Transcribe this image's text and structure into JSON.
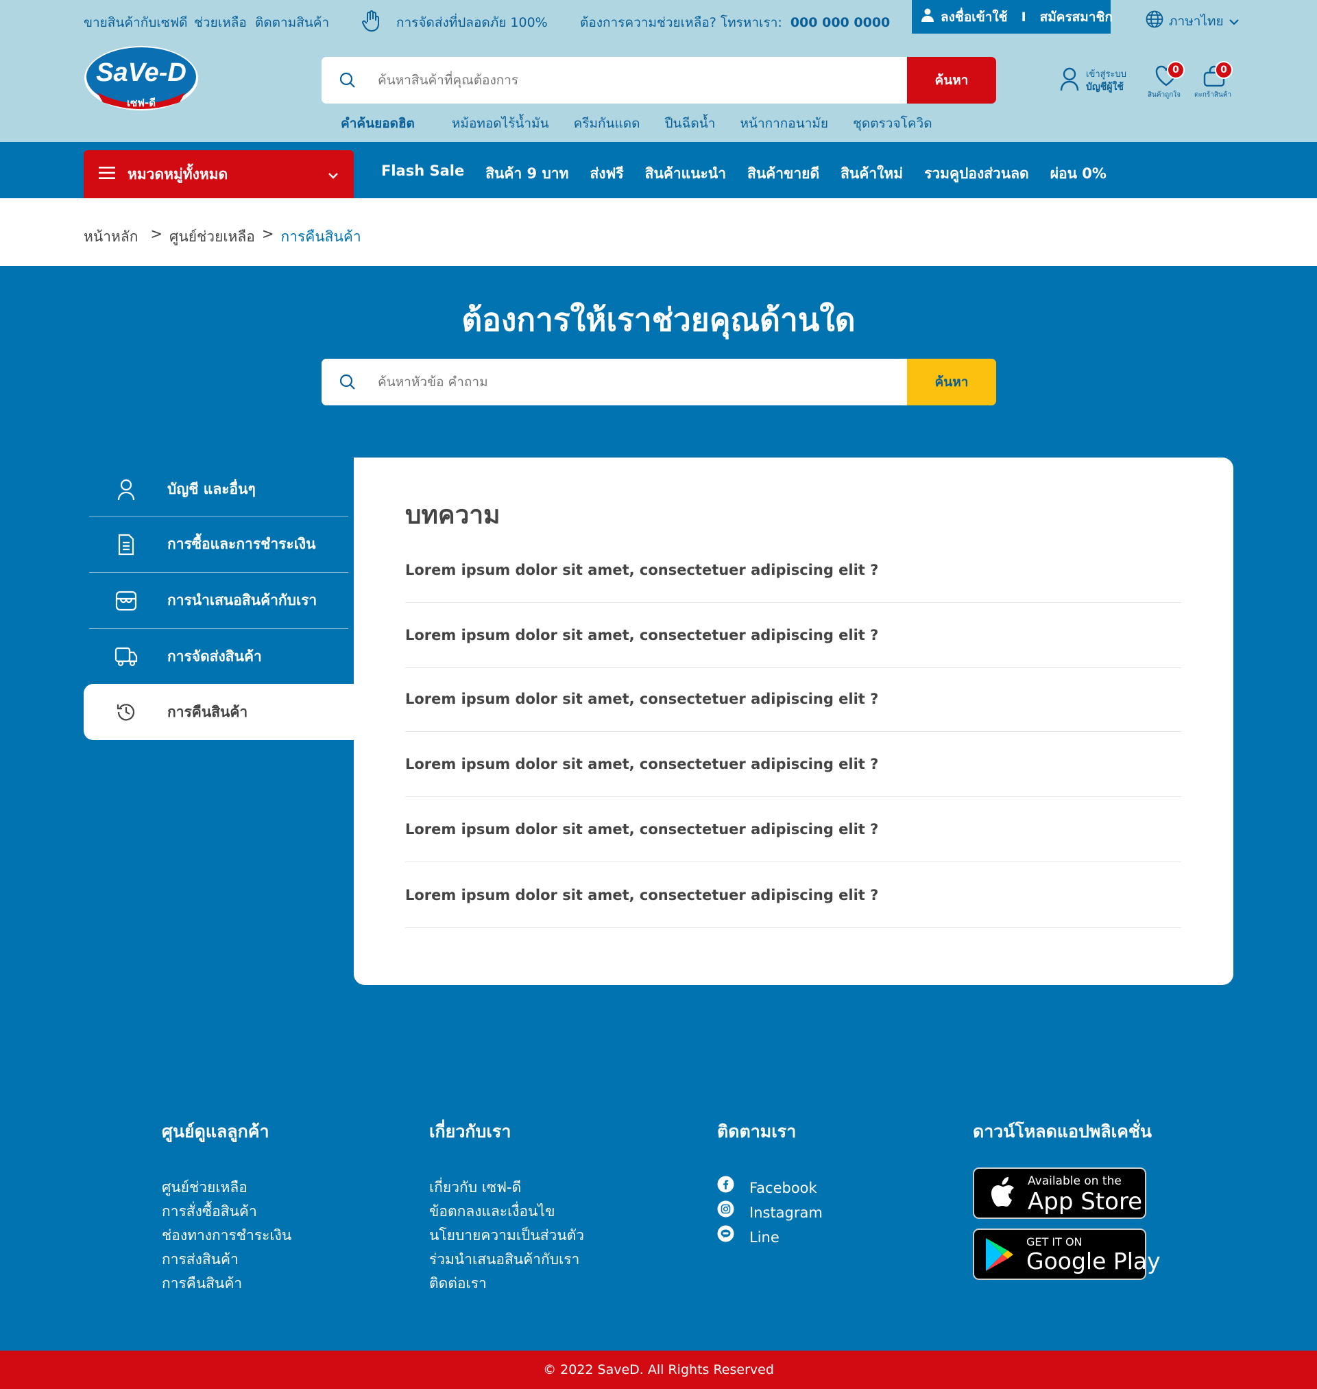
{
  "topbar": {
    "links": [
      "ขายสินค้ากับเซฟดี",
      "ช่วยเหลือ",
      "ติดตามสินค้า"
    ],
    "safe_delivery": "การจัดส่งที่ปลอดภัย 100%",
    "help_text": "ต้องการความช่วยเหลือ? โทรหาเรา:",
    "phone": "000 000 0000",
    "login": "ลงชื่อเข้าใช้",
    "divider": "I",
    "register": "สมัครสมาชิก",
    "language": "ภาษาไทย"
  },
  "logo": {
    "brand": "SaVe-D",
    "sub": "เซฟ-ดี"
  },
  "search": {
    "placeholder": "ค้นหาสินค้าที่คุณต้องการ",
    "button": "ค้นหา"
  },
  "hot_keywords": {
    "label": "คำค้นยอดฮิต",
    "items": [
      "หม้อทอดไร้น้ำมัน",
      "ครีมกันแดด",
      "ปืนฉีดน้ำ",
      "หน้ากากอนามัย",
      "ชุดตรวจโควิด"
    ]
  },
  "account": {
    "line1": "เข้าสู่ระบบ",
    "line2": "บัญชีผู้ใช้"
  },
  "wishlist": {
    "count": "0",
    "label": "สินค้าถูกใจ"
  },
  "cart": {
    "count": "0",
    "label": "ตะกร้าสินค้า"
  },
  "nav": {
    "categories": "หมวดหมู่ทั้งหมด",
    "links": [
      "Flash Sale",
      "สินค้า 9 บาท",
      "ส่งฟรี",
      "สินค้าแนะนำ",
      "สินค้าขายดี",
      "สินค้าใหม่",
      "รวมคูปองส่วนลด",
      "ผ่อน 0%"
    ]
  },
  "breadcrumb": [
    "หน้าหลัก",
    ">",
    "ศูนย์ช่วยเหลือ",
    ">",
    "การคืนสินค้า"
  ],
  "hero": {
    "title": "ต้องการให้เราช่วยคุณด้านใด",
    "placeholder": "ค้นหาหัวข้อ คำถาม",
    "button": "ค้นหา"
  },
  "sidebar": [
    {
      "label": "บัญชี และอื่นๆ",
      "icon": "user-icon"
    },
    {
      "label": "การซื้อและการชำระเงิน",
      "icon": "document-icon"
    },
    {
      "label": "การนำเสนอสินค้ากับเรา",
      "icon": "store-icon"
    },
    {
      "label": "การจัดส่งสินค้า",
      "icon": "truck-icon"
    },
    {
      "label": "การคืนสินค้า",
      "icon": "history-icon",
      "active": true
    }
  ],
  "articles": {
    "title": "บทความ",
    "items": [
      "Lorem ipsum dolor sit amet, consectetuer adipiscing elit ?",
      "Lorem ipsum dolor sit amet, consectetuer adipiscing elit ?",
      "Lorem ipsum dolor sit amet, consectetuer adipiscing elit ?",
      "Lorem ipsum dolor sit amet, consectetuer adipiscing elit ?",
      "Lorem ipsum dolor sit amet, consectetuer adipiscing elit ?",
      "Lorem ipsum dolor sit amet, consectetuer adipiscing elit ?"
    ]
  },
  "footer": {
    "customer": {
      "title": "ศูนย์ดูแลลูกค้า",
      "links": [
        "ศูนย์ช่วยเหลือ",
        "การสั่งซื้อสินค้า",
        "ช่องทางการชำระเงิน",
        "การส่งสินค้า",
        "การคืนสินค้า"
      ]
    },
    "about": {
      "title": "เกี่ยวกับเรา",
      "links": [
        "เกี่ยวกับ เซฟ-ดี",
        "ข้อตกลงและเงื่อนไข",
        "นโยบายความเป็นส่วนตัว",
        "ร่วมนำเสนอสินค้ากับเรา",
        "ติดต่อเรา"
      ]
    },
    "follow": {
      "title": "ติดตามเรา",
      "links": [
        "Facebook",
        "Instagram",
        "Line"
      ]
    },
    "app": {
      "title": "ดาวน์โหลดแอปพลิเคชั่น",
      "appstore_small": "Available on the",
      "appstore_big": "App Store",
      "gplay_small": "GET IT ON",
      "gplay_big": "Google Play"
    },
    "copyright": "© 2022 SaveD. All Rights Reserved"
  },
  "colors": {
    "brand_blue": "#0073b0",
    "light_blue": "#afd6e1",
    "red": "#d20a12",
    "yellow": "#fcc00f"
  }
}
